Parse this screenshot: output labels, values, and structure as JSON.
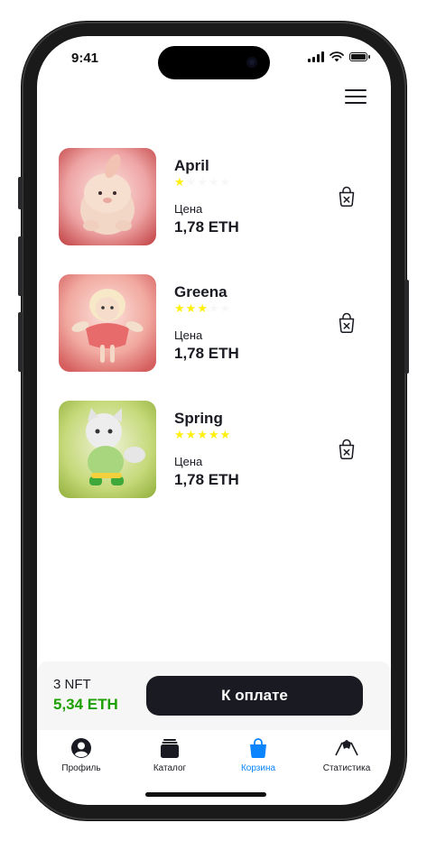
{
  "status_bar": {
    "time": "9:41"
  },
  "cart": {
    "items": [
      {
        "name": "April",
        "rating": 1,
        "price_label": "Цена",
        "price": "1,78 ETH"
      },
      {
        "name": "Greena",
        "rating": 3,
        "price_label": "Цена",
        "price": "1,78 ETH"
      },
      {
        "name": "Spring",
        "rating": 5,
        "price_label": "Цена",
        "price": "1,78 ETH"
      }
    ]
  },
  "checkout": {
    "count": "3 NFT",
    "total": "5,34 ETH",
    "pay_label": "К оплате"
  },
  "tab_bar": {
    "tabs": [
      {
        "label": "Профиль",
        "icon": "profile-icon",
        "active": false
      },
      {
        "label": "Каталог",
        "icon": "catalog-icon",
        "active": false
      },
      {
        "label": "Корзина",
        "icon": "cart-icon",
        "active": true
      },
      {
        "label": "Статистика",
        "icon": "statistics-icon",
        "active": false
      }
    ]
  },
  "colors": {
    "accent": "#0A84FF",
    "primary_text": "#1A1B22",
    "green_total": "#1C9F00",
    "star_active": "#FEEF0D",
    "star_inactive": "#F7F7F8"
  }
}
